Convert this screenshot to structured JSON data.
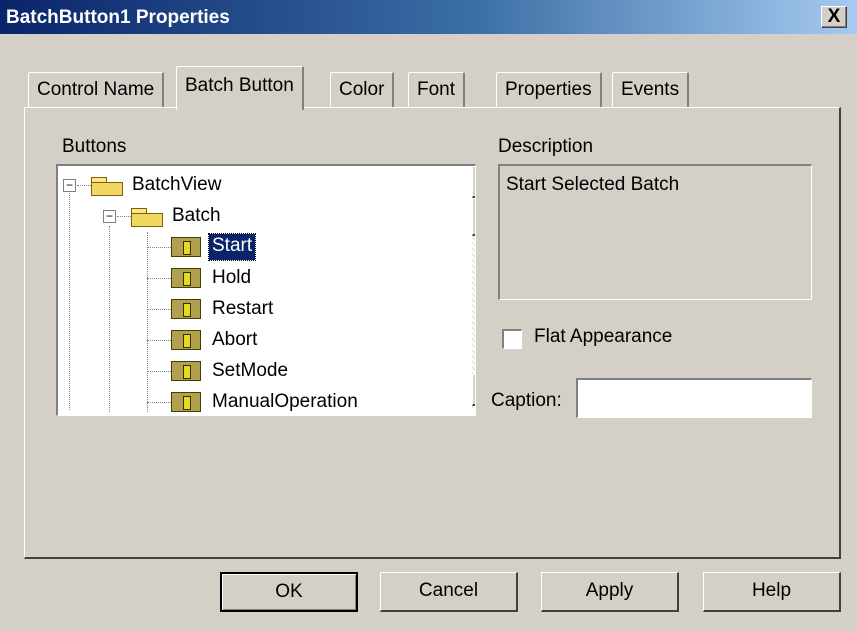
{
  "window": {
    "title": "BatchButton1 Properties",
    "close_label": "X"
  },
  "tabs": [
    {
      "label": "Control Name"
    },
    {
      "label": "Batch Button"
    },
    {
      "label": "Color"
    },
    {
      "label": "Font"
    },
    {
      "label": "Properties"
    },
    {
      "label": "Events"
    }
  ],
  "active_tab": "Batch Button",
  "buttons_panel": {
    "label": "Buttons",
    "tree": {
      "root": "BatchView",
      "group": "Batch",
      "items": [
        "Start",
        "Hold",
        "Restart",
        "Abort",
        "SetMode",
        "ManualOperation"
      ],
      "selected": "Start"
    }
  },
  "description": {
    "label": "Description",
    "text": "Start Selected Batch"
  },
  "flat_appearance": {
    "label": "Flat Appearance",
    "checked": false
  },
  "caption": {
    "label": "Caption:",
    "value": ""
  },
  "dialog_buttons": {
    "ok": "OK",
    "cancel": "Cancel",
    "apply": "Apply",
    "help": "Help"
  },
  "colors": {
    "title_start": "#0a246a",
    "title_end": "#a6caf0",
    "selection": "#0a246a",
    "face": "#d4d0c8"
  },
  "icons": [
    "folder-icon",
    "batch-button-icon",
    "expand-collapse-icon"
  ]
}
